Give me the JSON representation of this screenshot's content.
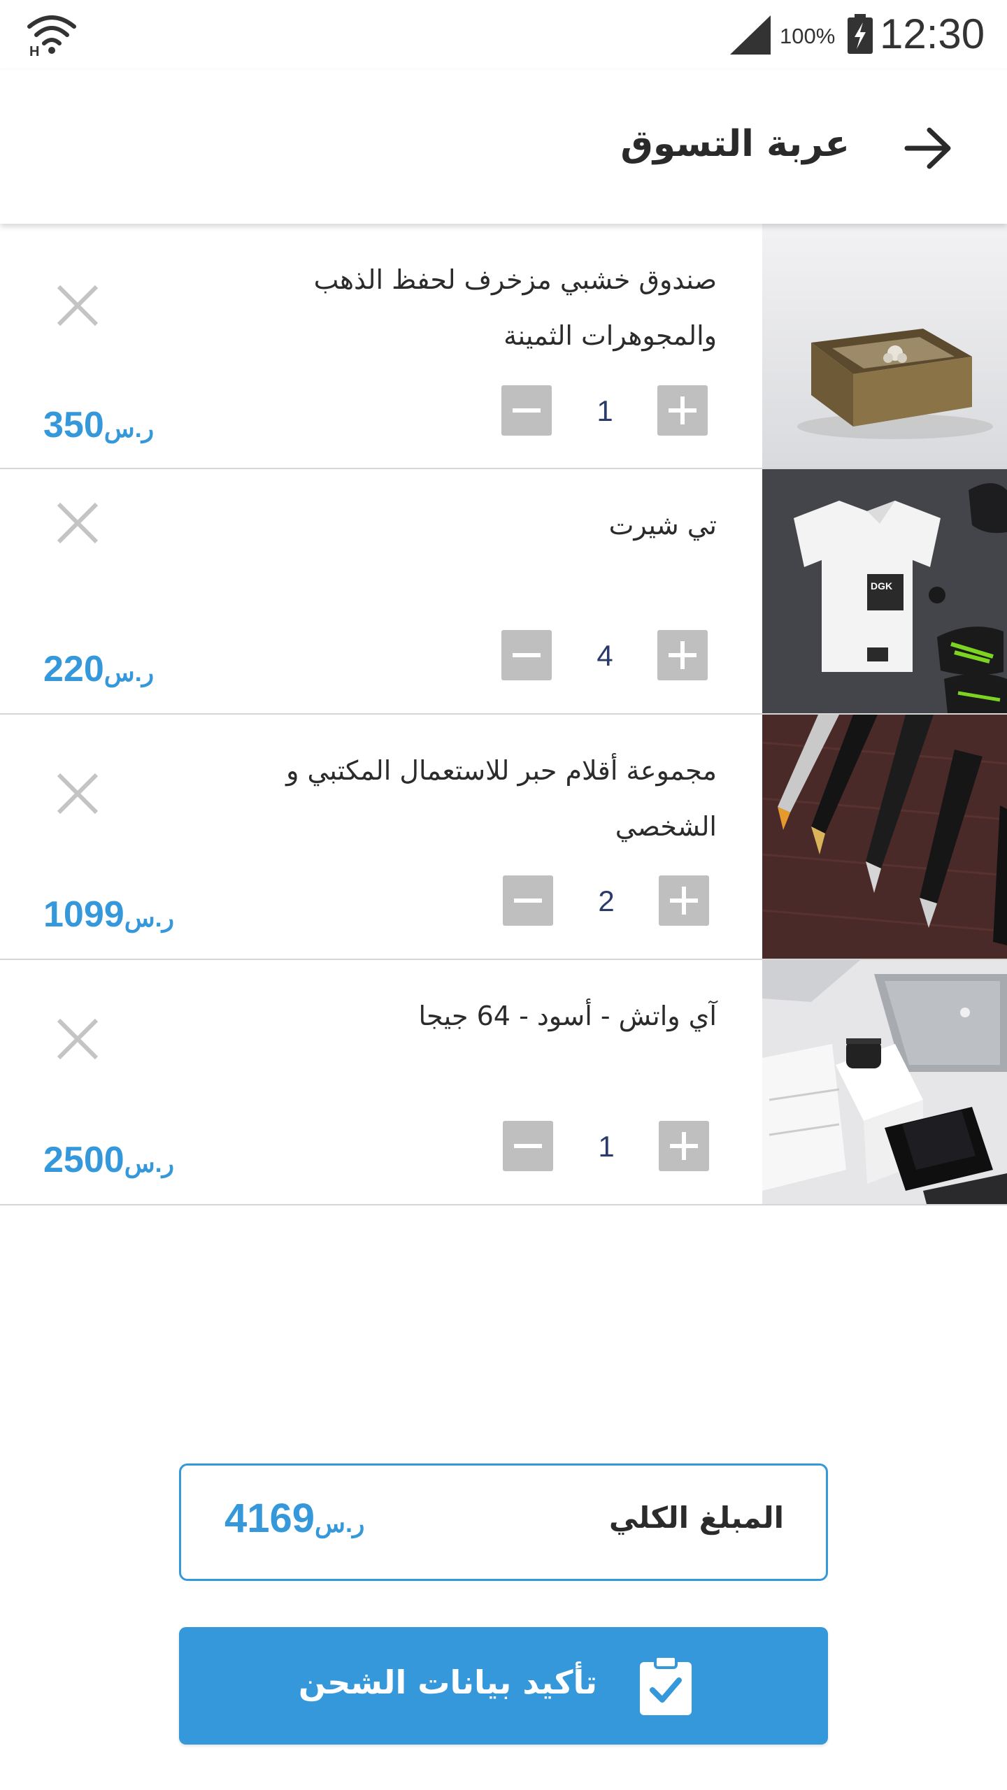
{
  "status_bar": {
    "battery_percent": "100%",
    "time": "12:30",
    "icons": [
      "wifi-icon",
      "signal-icon",
      "battery-charging-icon"
    ]
  },
  "header": {
    "title": "عربة التسوق",
    "back_icon": "arrow-right-icon"
  },
  "cart": {
    "items": [
      {
        "name": "صندوق خشبي مزخرف لحفظ الذهب والمجوهرات الثمينة",
        "quantity": "1",
        "price": "350",
        "currency": "ر.س",
        "image": "wooden-jewelry-box-image"
      },
      {
        "name": "تي شيرت",
        "quantity": "4",
        "price": "220",
        "currency": "ر.س",
        "image": "white-tshirt-image"
      },
      {
        "name": "مجموعة أقلام حبر  للاستعمال المكتبي و الشخصي",
        "quantity": "2",
        "price": "1099",
        "currency": "ر.س",
        "image": "fountain-pens-image"
      },
      {
        "name": "آي واتش - أسود - 64 جيجا",
        "quantity": "1",
        "price": "2500",
        "currency": "ر.س",
        "image": "apple-watch-devices-image"
      }
    ]
  },
  "total": {
    "label": "المبلغ الكلي",
    "amount": "4169",
    "currency": "ر.س"
  },
  "confirm_button": {
    "label": "تأكيد بيانات الشحن",
    "icon": "clipboard-check-icon"
  },
  "colors": {
    "accent": "#3498db",
    "qty_button": "#bfbfbf",
    "text": "#2b2b2b",
    "divider": "#d6d6d6"
  }
}
